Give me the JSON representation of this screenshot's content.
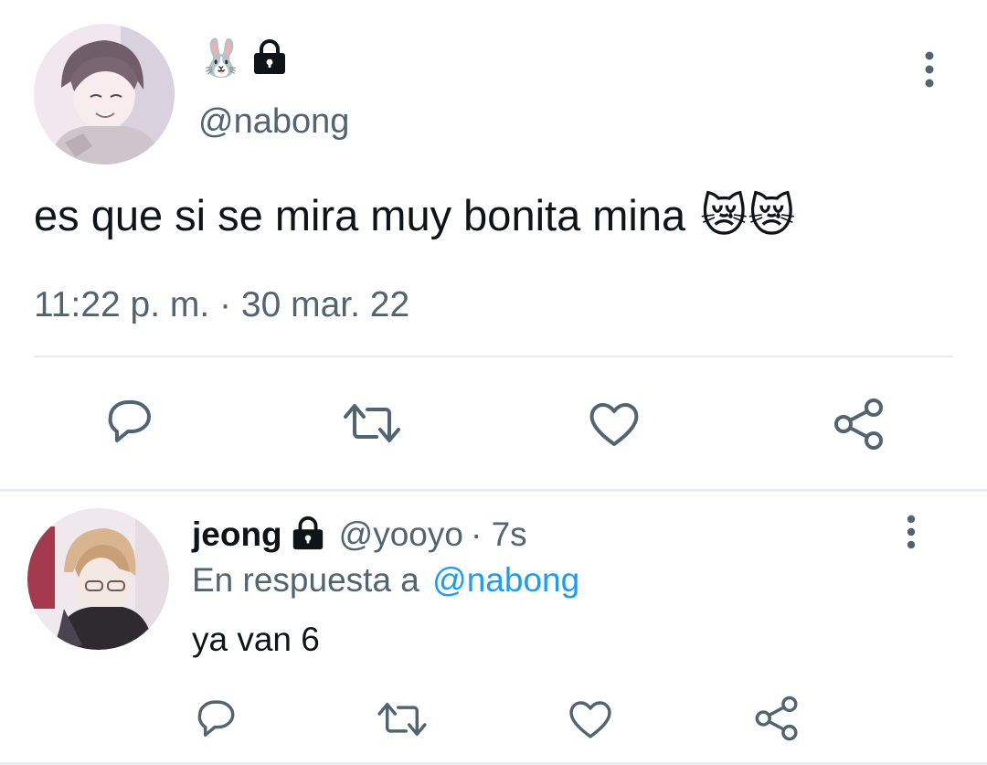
{
  "main_tweet": {
    "display_name_emoji": "🐰",
    "handle": "@nabong",
    "text": "es que si se mira muy bonita mina",
    "text_emoji": "😿😿",
    "timestamp": "11:22 p. m. · 30 mar. 22"
  },
  "reply_tweet": {
    "display_name": "jeong",
    "handle": "@yooyo",
    "age": "· 7s",
    "replying_prefix": "En respuesta a",
    "replying_to": "@nabong",
    "text": "ya van 6"
  },
  "actions": [
    "reply-icon",
    "retweet-icon",
    "like-icon",
    "share-icon"
  ],
  "colors": {
    "text": "#0f1419",
    "muted": "#536471",
    "link": "#1d9bf0",
    "divider": "#e6ecf0"
  }
}
